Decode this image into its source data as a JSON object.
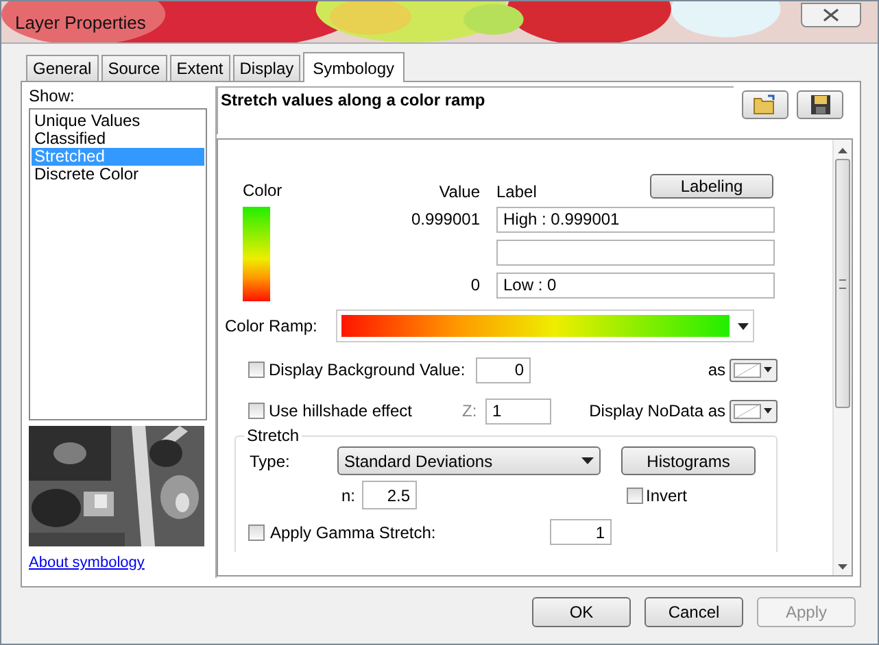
{
  "window": {
    "title": "Layer Properties"
  },
  "tabs": [
    {
      "label": "General",
      "selected": false
    },
    {
      "label": "Source",
      "selected": false
    },
    {
      "label": "Extent",
      "selected": false
    },
    {
      "label": "Display",
      "selected": false
    },
    {
      "label": "Symbology",
      "selected": true
    }
  ],
  "show": {
    "label": "Show:",
    "items": [
      {
        "label": "Unique Values",
        "selected": false
      },
      {
        "label": "Classified",
        "selected": false
      },
      {
        "label": "Stretched",
        "selected": true
      },
      {
        "label": "Discrete Color",
        "selected": false
      }
    ],
    "link": "About symbology"
  },
  "header": {
    "title": "Stretch values along a color ramp"
  },
  "table": {
    "color_header": "Color",
    "value_header": "Value",
    "label_header": "Label",
    "labeling_button": "Labeling",
    "rows": [
      {
        "value": "0.999001",
        "label": "High : 0.999001"
      },
      {},
      {
        "value": "0",
        "label": "Low : 0"
      }
    ]
  },
  "color_ramp": {
    "label": "Color Ramp:"
  },
  "background": {
    "label": "Display Background Value:",
    "checked": false,
    "value": "0",
    "as_label": "as"
  },
  "hillshade": {
    "label": "Use hillshade effect",
    "checked": false,
    "z_label": "Z:",
    "z_value": "1",
    "nodata_label": "Display NoData as"
  },
  "stretch": {
    "title": "Stretch",
    "type_label": "Type:",
    "type_value": "Standard Deviations",
    "histograms": "Histograms",
    "n_label": "n:",
    "n_value": "2.5",
    "invert": {
      "label": "Invert",
      "checked": false
    },
    "gamma": {
      "label": "Apply Gamma Stretch:",
      "checked": false,
      "value": "1"
    }
  },
  "buttons": [
    {
      "label": "OK",
      "disabled": false
    },
    {
      "label": "Cancel",
      "disabled": false
    },
    {
      "label": "Apply",
      "disabled": true
    }
  ]
}
